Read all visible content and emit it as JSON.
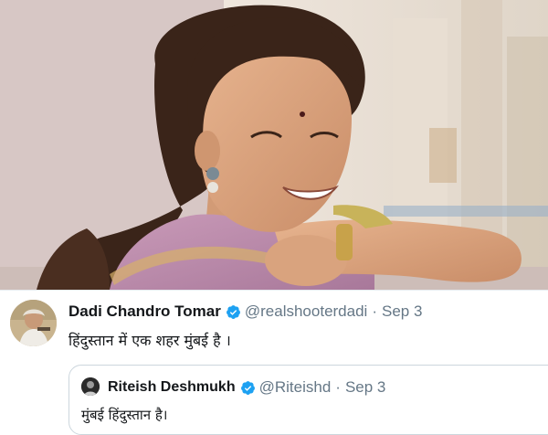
{
  "tweet": {
    "author_name": "Dadi Chandro Tomar",
    "handle": "@realshooterdadi",
    "separator": "·",
    "date": "Sep 3",
    "text": "हिंदुस्तान में एक शहर मुंबई है ।"
  },
  "quoted_tweet": {
    "author_name": "Riteish Deshmukh",
    "handle": "@Riteishd",
    "separator": "·",
    "date": "Sep 3",
    "text": "मुंबई हिंदुस्तान है।"
  },
  "icons": {
    "verified_badge": "verified-badge-icon",
    "verified_color": "#1da1f2"
  }
}
